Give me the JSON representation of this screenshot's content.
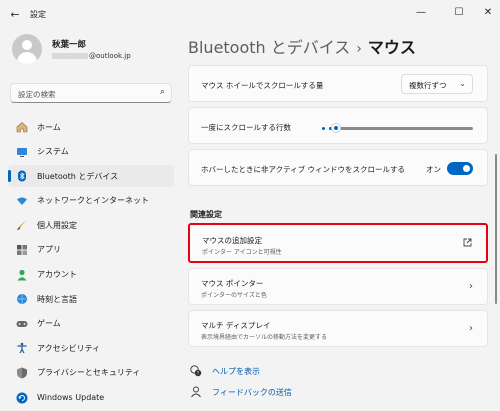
{
  "app": {
    "title": "設定"
  },
  "profile": {
    "name": "秋葉一郎",
    "email_suffix": "@outlook.jp"
  },
  "search": {
    "placeholder": "設定の検索"
  },
  "nav": {
    "items": [
      {
        "label": "ホーム",
        "icon": "home-icon"
      },
      {
        "label": "システム",
        "icon": "system-icon"
      },
      {
        "label": "Bluetooth とデバイス",
        "icon": "bluetooth-icon",
        "selected": true
      },
      {
        "label": "ネットワークとインターネット",
        "icon": "wifi-icon"
      },
      {
        "label": "個人用設定",
        "icon": "brush-icon"
      },
      {
        "label": "アプリ",
        "icon": "apps-icon"
      },
      {
        "label": "アカウント",
        "icon": "account-icon"
      },
      {
        "label": "時刻と言語",
        "icon": "globe-clock-icon"
      },
      {
        "label": "ゲーム",
        "icon": "gamepad-icon"
      },
      {
        "label": "アクセシビリティ",
        "icon": "accessibility-icon"
      },
      {
        "label": "プライバシーとセキュリティ",
        "icon": "shield-icon"
      },
      {
        "label": "Windows Update",
        "icon": "update-icon"
      }
    ]
  },
  "header": {
    "parent": "Bluetooth とデバイス",
    "separator": "›",
    "current": "マウス"
  },
  "settings": {
    "scroll_amount": {
      "label": "マウス ホイールでスクロールする量",
      "value": "複数行ずつ"
    },
    "scroll_lines": {
      "label": "一度にスクロールする行数",
      "value_fraction": 0.05
    },
    "inactive_scroll": {
      "label": "ホバーしたときに非アクティブ ウィンドウをスクロールする",
      "state": "オン",
      "on": true
    }
  },
  "related": {
    "section_title": "関連設定",
    "cards": [
      {
        "title": "マウスの追加設定",
        "subtitle": "ポインター アイコンと可視性"
      },
      {
        "title": "マウス ポインター",
        "subtitle": "ポインターのサイズと色"
      },
      {
        "title": "マルチ ディスプレイ",
        "subtitle": "表示境界経由でカーソルの移動方法を変更する"
      }
    ]
  },
  "links": {
    "help": "ヘルプを表示",
    "feedback": "フィードバックの送信"
  },
  "colors": {
    "accent": "#0067c0",
    "highlight": "#e60012",
    "link": "#0058b0"
  }
}
